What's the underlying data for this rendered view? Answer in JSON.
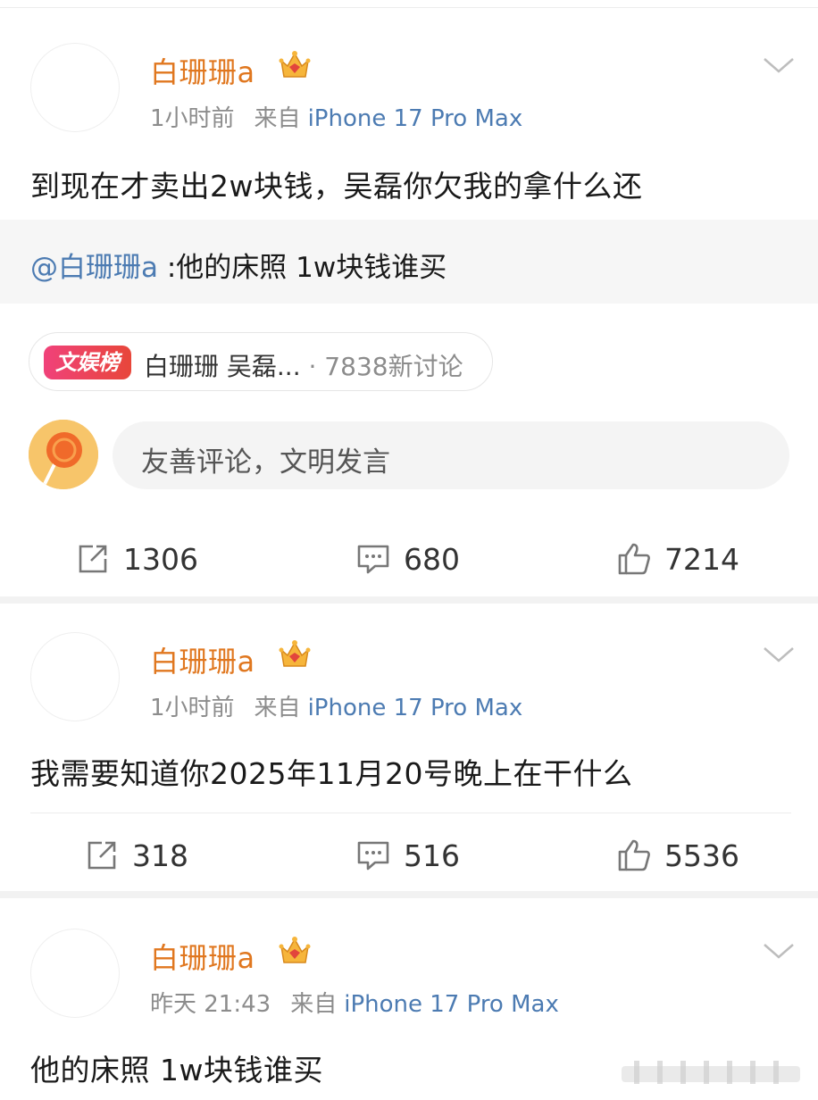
{
  "posts": [
    {
      "author": "白珊珊a",
      "time": "1小时前",
      "from_label": "来自",
      "device": "iPhone 17 Pro Max",
      "content": "到现在才卖出2w块钱，吴磊你欠我的拿什么还",
      "quote": {
        "user": "@白珊珊a",
        "text": " :他的床照 1w块钱谁买"
      },
      "topic": {
        "badge": "文娱榜",
        "title": "白珊珊 吴磊...",
        "count": " · 7838新讨论"
      },
      "comment_placeholder": "友善评论，文明发言",
      "reposts": "1306",
      "comments": "680",
      "likes": "7214"
    },
    {
      "author": "白珊珊a",
      "time": "1小时前",
      "from_label": "来自",
      "device": "iPhone 17 Pro Max",
      "content": "我需要知道你2025年11月20号晚上在干什么",
      "reposts": "318",
      "comments": "516",
      "likes": "5536"
    },
    {
      "author": "白珊珊a",
      "time": "昨天 21:43",
      "from_label": "来自",
      "device": "iPhone 17 Pro Max",
      "content": "他的床照 1w块钱谁买"
    }
  ],
  "icons": {
    "share": "share-icon",
    "comment": "comment-icon",
    "like": "thumbs-up-icon",
    "crown": "crown-badge-icon",
    "chevron": "chevron-down-icon"
  },
  "colors": {
    "author": "#e0771f",
    "link": "#4c7bb2",
    "meta": "#8c8c8c",
    "badge": "#e8463a"
  }
}
